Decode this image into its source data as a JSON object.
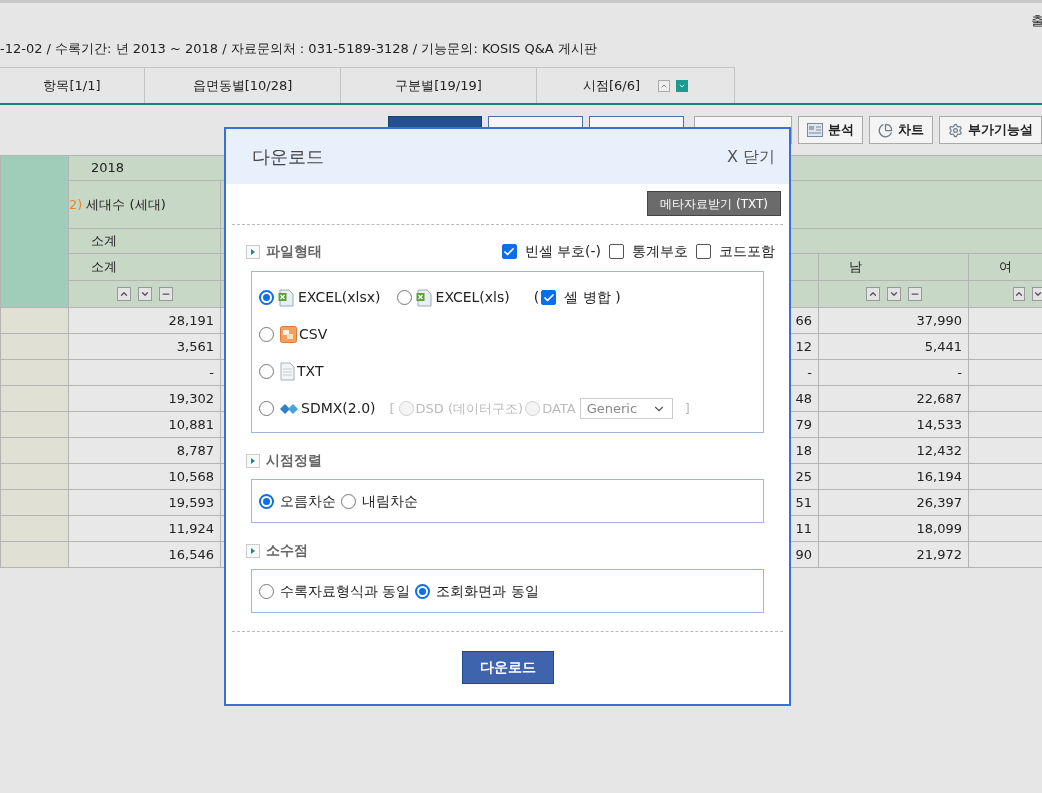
{
  "header": {
    "corner_text": "출",
    "info": "-12-02 / 수록기간: 년 2013 ~ 2018 / 자료문의처 : 031-5189-3128 / 기능문의: KOSIS Q&A 게시판"
  },
  "tabs": [
    {
      "label": "항목[1/1]"
    },
    {
      "label": "읍면동별[10/28]"
    },
    {
      "label": "구분별[19/19]"
    },
    {
      "label": "시점[6/6]",
      "sort_icons": true
    }
  ],
  "toolbar": {
    "buttons": [
      {
        "label": "분석",
        "kind": "analysis"
      },
      {
        "label": "차트",
        "kind": "chart"
      },
      {
        "label": "부가기능설",
        "kind": "settings"
      }
    ]
  },
  "table": {
    "year": "2018",
    "measure": {
      "note": "2)",
      "label": "세대수 (세대)"
    },
    "subtotal_1": "소계",
    "subtotal_2": "소계",
    "columns": [
      "남",
      "여"
    ],
    "rows": [
      {
        "total": "28,191",
        "column_2": "66",
        "male": "37,990"
      },
      {
        "total": "3,561",
        "column_2": "12",
        "male": "5,441"
      },
      {
        "total": "-",
        "column_2": "-",
        "male": "-"
      },
      {
        "total": "19,302",
        "column_2": "48",
        "male": "22,687"
      },
      {
        "total": "10,881",
        "column_2": "79",
        "male": "14,533"
      },
      {
        "total": "8,787",
        "column_2": "18",
        "male": "12,432"
      },
      {
        "total": "10,568",
        "column_2": "25",
        "male": "16,194"
      },
      {
        "total": "19,593",
        "column_2": "51",
        "male": "26,397"
      },
      {
        "total": "11,924",
        "column_2": "11",
        "male": "18,099"
      },
      {
        "total": "16,546",
        "column_2": "90",
        "male": "21,972"
      }
    ]
  },
  "dialog": {
    "title": "다운로드",
    "close": "X 닫기",
    "meta_button": "메타자료받기 (TXT)",
    "file_section": {
      "title": "파일형태",
      "options": [
        {
          "label": "빈셀 부호(-)",
          "checked": true
        },
        {
          "label": "통계부호",
          "checked": false
        },
        {
          "label": "코드포함",
          "checked": false
        }
      ],
      "formats": [
        {
          "kind": "excel",
          "label": "EXCEL(xlsx)",
          "selected": true
        },
        {
          "kind": "excel",
          "label": "EXCEL(xls)",
          "selected": false
        },
        {
          "kind": "csv",
          "label": "CSV",
          "selected": false
        },
        {
          "kind": "txt",
          "label": "TXT",
          "selected": false
        },
        {
          "kind": "sdmx",
          "label": "SDMX(2.0)",
          "selected": false
        }
      ],
      "merge": {
        "open": "(",
        "label": "셀 병합 )",
        "checked": true
      },
      "sdmx": {
        "open": "[",
        "close": "]",
        "options": [
          {
            "label": "DSD (데이터구조)",
            "selected": false,
            "disabled": true
          },
          {
            "label": "DATA",
            "selected": false,
            "disabled": true
          }
        ],
        "select": "Generic"
      }
    },
    "sort_section": {
      "title": "시점정렬",
      "options": [
        {
          "label": "오름차순",
          "selected": true
        },
        {
          "label": "내림차순",
          "selected": false
        }
      ]
    },
    "decimal_section": {
      "title": "소수점",
      "options": [
        {
          "label": "수록자료형식과 동일",
          "selected": false
        },
        {
          "label": "조회화면과 동일",
          "selected": true
        }
      ]
    },
    "download_button": "다운로드"
  }
}
